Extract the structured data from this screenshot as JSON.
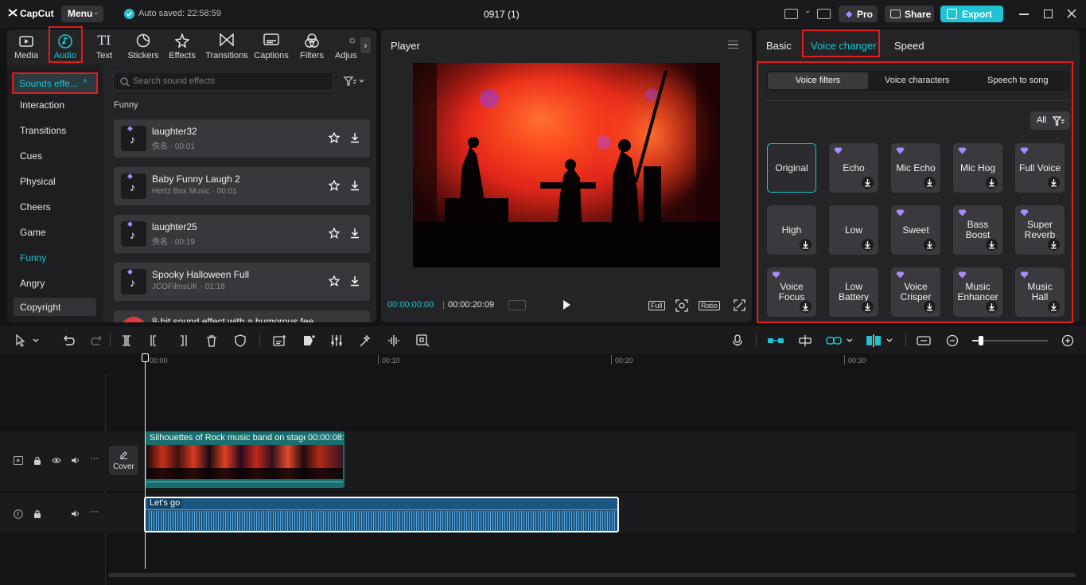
{
  "app": {
    "logo_text": "CapCut",
    "menu_label": "Menu",
    "autosave": "Auto saved: 22:58:59",
    "project_title": "0917 (1)",
    "pro_label": "Pro",
    "share_label": "Share",
    "export_label": "Export"
  },
  "left_tabs": [
    {
      "label": "Media",
      "icon": "media-icon"
    },
    {
      "label": "Audio",
      "icon": "audio-icon"
    },
    {
      "label": "Text",
      "icon": "text-icon"
    },
    {
      "label": "Stickers",
      "icon": "stickers-icon"
    },
    {
      "label": "Effects",
      "icon": "effects-icon"
    },
    {
      "label": "Transitions",
      "icon": "transitions-icon"
    },
    {
      "label": "Captions",
      "icon": "captions-icon"
    },
    {
      "label": "Filters",
      "icon": "filters-icon"
    },
    {
      "label": "Adjus",
      "icon": "adjust-icon"
    }
  ],
  "sound_effects": {
    "dropdown_label": "Sounds effe...",
    "search_placeholder": "Search sound effects",
    "categories": [
      "Interaction",
      "Transitions",
      "Cues",
      "Physical",
      "Cheers",
      "Game",
      "Funny",
      "Angry",
      "Copyright"
    ],
    "active_category": "Funny",
    "section_title": "Funny",
    "items": [
      {
        "title": "laughter32",
        "artist": "佚名",
        "duration": "00:01"
      },
      {
        "title": "Baby Funny Laugh 2",
        "artist": "Hertz Box Music",
        "duration": "00:01"
      },
      {
        "title": "laughter25",
        "artist": "佚名",
        "duration": "00:19"
      },
      {
        "title": "Spooky Halloween Full",
        "artist": "JCOFilmsUK",
        "duration": "01:18"
      },
      {
        "title": "8-bit sound effect with a humorous fee",
        "artist": "",
        "duration": ""
      }
    ]
  },
  "player": {
    "title": "Player",
    "current_time": "00:00:00:00",
    "total_time": "00:00:20:09",
    "full_label": "Full",
    "ratio_label": "Ratio"
  },
  "right_panel": {
    "tabs": [
      "Basic",
      "Voice changer",
      "Speed"
    ],
    "active_tab": "Voice changer",
    "subtabs": [
      "Voice filters",
      "Voice characters",
      "Speech to song"
    ],
    "active_subtab": "Voice filters",
    "filter_label": "All",
    "tiles": [
      {
        "label": "Original",
        "pro": false,
        "download": false,
        "selected": true
      },
      {
        "label": "Echo",
        "pro": true,
        "download": true
      },
      {
        "label": "Mic Echo",
        "pro": true,
        "download": true
      },
      {
        "label": "Mic Hog",
        "pro": true,
        "download": true
      },
      {
        "label": "Full Voice",
        "pro": true,
        "download": true
      },
      {
        "label": "High",
        "pro": false,
        "download": true
      },
      {
        "label": "Low",
        "pro": false,
        "download": true
      },
      {
        "label": "Sweet",
        "pro": true,
        "download": true
      },
      {
        "label": "Bass Boost",
        "pro": true,
        "download": true
      },
      {
        "label": "Super Reverb",
        "pro": true,
        "download": true
      },
      {
        "label": "Voice Focus",
        "pro": true,
        "download": true
      },
      {
        "label": "Low Battery",
        "pro": false,
        "download": true
      },
      {
        "label": "Voice Crisper",
        "pro": true,
        "download": true
      },
      {
        "label": "Music Enhancer",
        "pro": true,
        "download": true
      },
      {
        "label": "Music Hall",
        "pro": true,
        "download": true
      }
    ]
  },
  "timeline": {
    "ruler": [
      "00:00",
      "00:10",
      "00:20",
      "00:30"
    ],
    "video_clip": {
      "title": "Silhouettes of Rock music band on stage",
      "duration": "00:00:08:"
    },
    "cover_label": "Cover",
    "audio_clip": {
      "title": "Let's go"
    }
  },
  "colors": {
    "accent": "#1fc3d1",
    "pro": "#a98bff",
    "highlight_box": "#e11d1d"
  }
}
